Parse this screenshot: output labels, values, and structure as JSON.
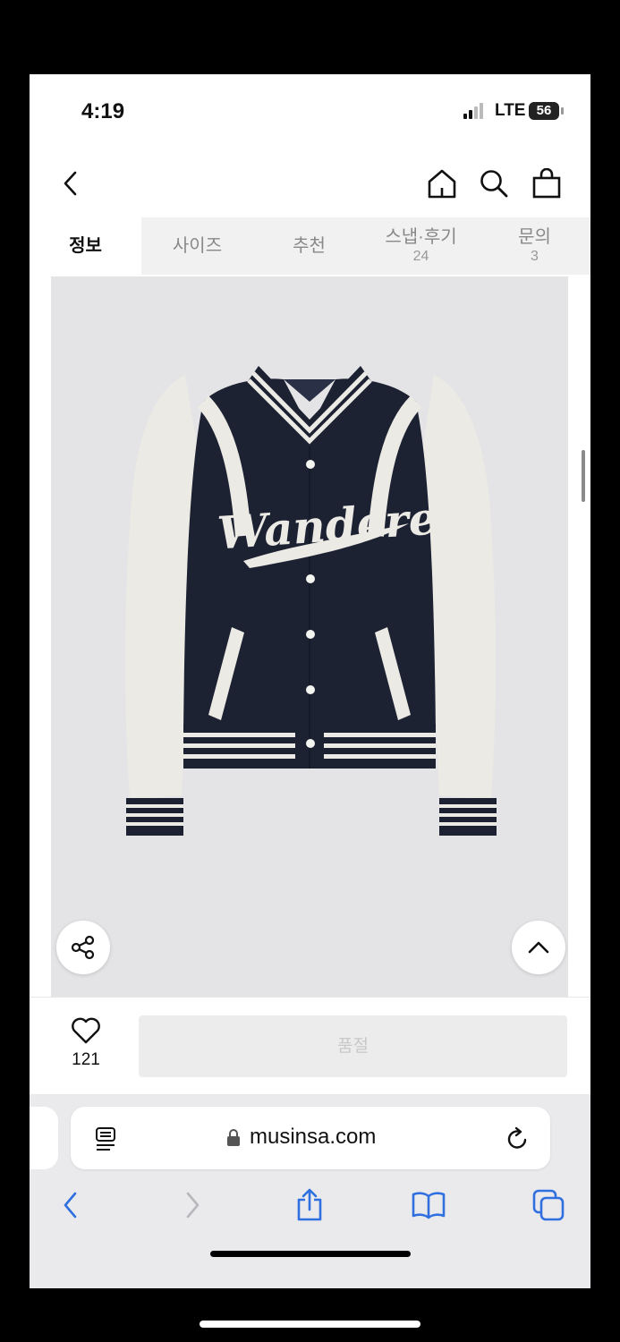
{
  "status": {
    "time": "4:19",
    "network": "LTE",
    "battery": "56"
  },
  "nav": {
    "icons": [
      "back-chevron-icon",
      "home-icon",
      "search-icon",
      "shopping-bag-icon"
    ]
  },
  "tabs": [
    {
      "label": "정보",
      "count": ""
    },
    {
      "label": "사이즈",
      "count": ""
    },
    {
      "label": "추천",
      "count": ""
    },
    {
      "label": "스냅·후기",
      "count": "24"
    },
    {
      "label": "문의",
      "count": "3"
    }
  ],
  "product": {
    "image_text": "Wanderer",
    "colors": {
      "body": "#1d2233",
      "sleeve": "#ecebe6",
      "background": "#e4e4e6"
    }
  },
  "buy": {
    "like_count": "121",
    "soldout_label": "품절"
  },
  "browser": {
    "url": "musinsa.com"
  }
}
